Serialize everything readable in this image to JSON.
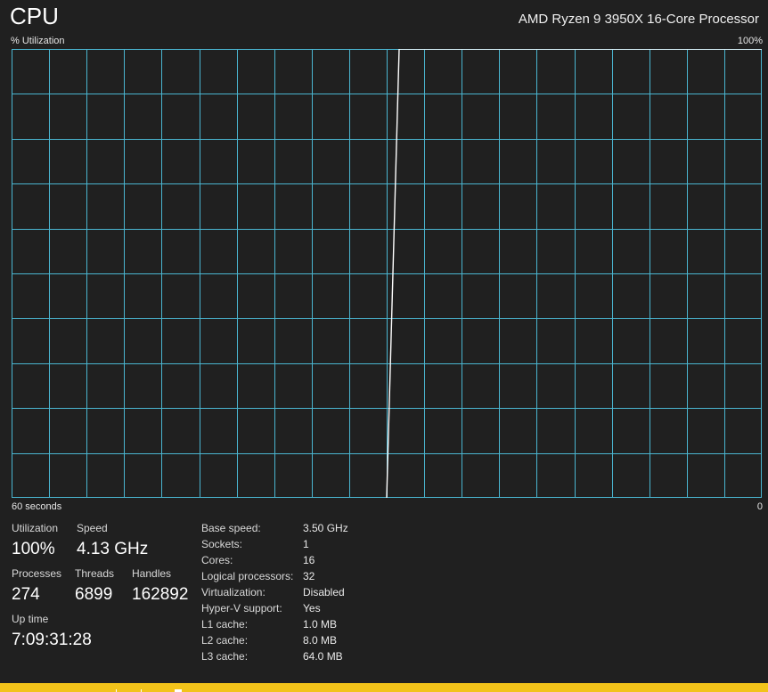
{
  "header": {
    "title": "CPU",
    "processor_name": "AMD Ryzen 9 3950X 16-Core Processor"
  },
  "graph": {
    "y_label": "% Utilization",
    "y_max_label": "100%",
    "x_label": "60 seconds",
    "x_min_label": "0",
    "grid_color": "#4ab5d0",
    "line_color": "#ffffff",
    "background": "#202020"
  },
  "chart_data": {
    "type": "line",
    "ylabel": "% Utilization",
    "xlabel": "60 seconds",
    "ylim": [
      0,
      100
    ],
    "xlim": [
      60,
      0
    ],
    "grid": true,
    "x": [
      60,
      30,
      29,
      0
    ],
    "series": [
      {
        "values": [
          null,
          0,
          100,
          100
        ]
      }
    ]
  },
  "stats": {
    "utilization": {
      "label": "Utilization",
      "value": "100%"
    },
    "speed": {
      "label": "Speed",
      "value": "4.13 GHz"
    },
    "processes": {
      "label": "Processes",
      "value": "274"
    },
    "threads": {
      "label": "Threads",
      "value": "6899"
    },
    "handles": {
      "label": "Handles",
      "value": "162892"
    },
    "uptime": {
      "label": "Up time",
      "value": "7:09:31:28"
    }
  },
  "specs": [
    {
      "label": "Base speed:",
      "value": "3.50 GHz"
    },
    {
      "label": "Sockets:",
      "value": "1"
    },
    {
      "label": "Cores:",
      "value": "16"
    },
    {
      "label": "Logical processors:",
      "value": "32"
    },
    {
      "label": "Virtualization:",
      "value": "Disabled"
    },
    {
      "label": "Hyper-V support:",
      "value": "Yes"
    },
    {
      "label": "L1 cache:",
      "value": "1.0 MB"
    },
    {
      "label": "L2 cache:",
      "value": "8.0 MB"
    },
    {
      "label": "L3 cache:",
      "value": "64.0 MB"
    }
  ],
  "taskbar": {
    "color": "#f2c31a"
  }
}
